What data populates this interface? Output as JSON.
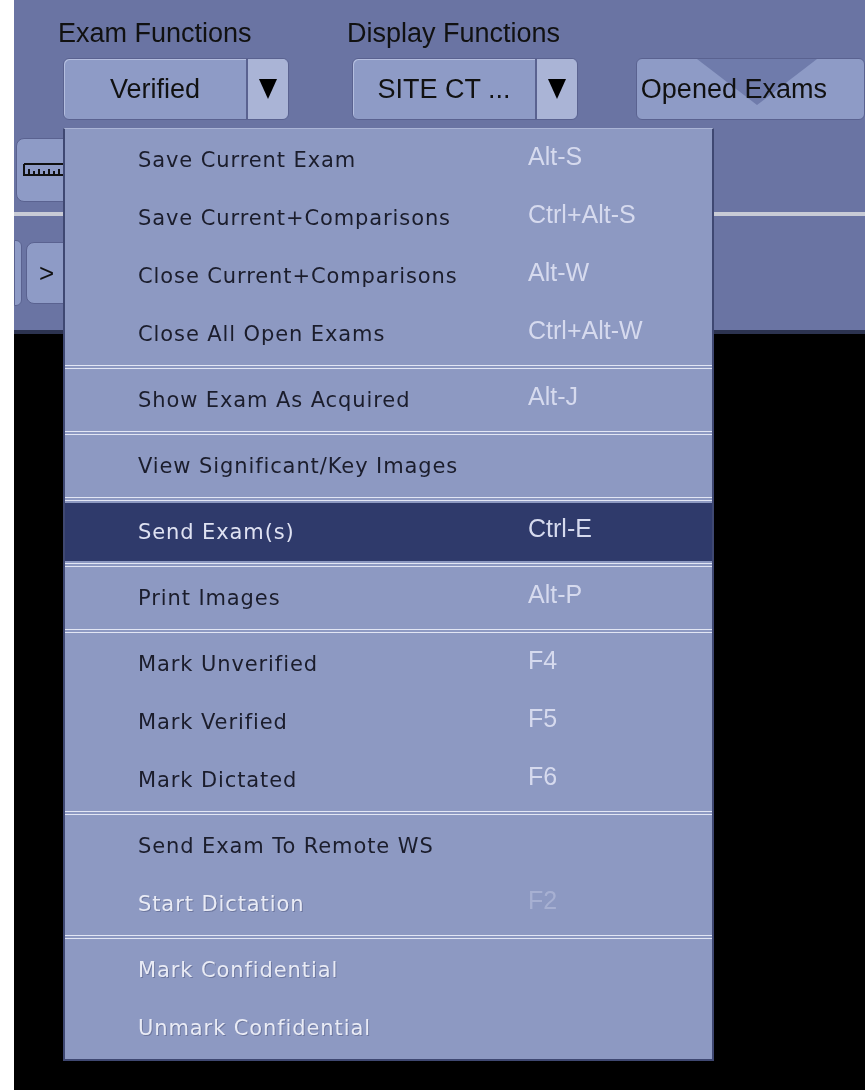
{
  "header": {
    "groups": [
      {
        "label": "Exam Functions",
        "value": "Verified",
        "kind": "dropdown"
      },
      {
        "label": "Display Functions",
        "value": "SITE CT ...",
        "kind": "dropdown"
      }
    ],
    "opened_exams_button": "Opened Exams"
  },
  "toolbar": {
    "next_button": ">"
  },
  "menu": {
    "groups": [
      {
        "items": [
          {
            "label": "Save Current Exam",
            "shortcut": "Alt-S",
            "selected": false,
            "disabled": false
          },
          {
            "label": "Save Current+Comparisons",
            "shortcut": "Ctrl+Alt-S",
            "selected": false,
            "disabled": false
          },
          {
            "label": "Close Current+Comparisons",
            "shortcut": "Alt-W",
            "selected": false,
            "disabled": false
          },
          {
            "label": "Close All Open Exams",
            "shortcut": "Ctrl+Alt-W",
            "selected": false,
            "disabled": false
          }
        ]
      },
      {
        "items": [
          {
            "label": "Show Exam As Acquired",
            "shortcut": "Alt-J",
            "selected": false,
            "disabled": false
          }
        ]
      },
      {
        "items": [
          {
            "label": "View Significant/Key Images",
            "selected": false,
            "disabled": false
          }
        ]
      },
      {
        "items": [
          {
            "label": "Send Exam(s)",
            "shortcut": "Ctrl-E",
            "selected": true,
            "disabled": false
          }
        ]
      },
      {
        "items": [
          {
            "label": "Print Images",
            "shortcut": "Alt-P",
            "selected": false,
            "disabled": false
          }
        ]
      },
      {
        "items": [
          {
            "label": "Mark Unverified",
            "shortcut": "F4",
            "selected": false,
            "disabled": false
          },
          {
            "label": "Mark Verified",
            "shortcut": "F5",
            "selected": false,
            "disabled": false
          },
          {
            "label": "Mark Dictated",
            "shortcut": "F6",
            "selected": false,
            "disabled": false
          }
        ]
      },
      {
        "items": [
          {
            "label": "Send Exam To Remote WS",
            "selected": false,
            "disabled": false
          },
          {
            "label": "Start Dictation",
            "shortcut": "F2",
            "selected": false,
            "disabled": true
          }
        ]
      },
      {
        "items": [
          {
            "label": "Mark Confidential",
            "selected": false,
            "disabled": true
          },
          {
            "label": "Unmark Confidential",
            "selected": false,
            "disabled": true
          }
        ]
      }
    ]
  }
}
